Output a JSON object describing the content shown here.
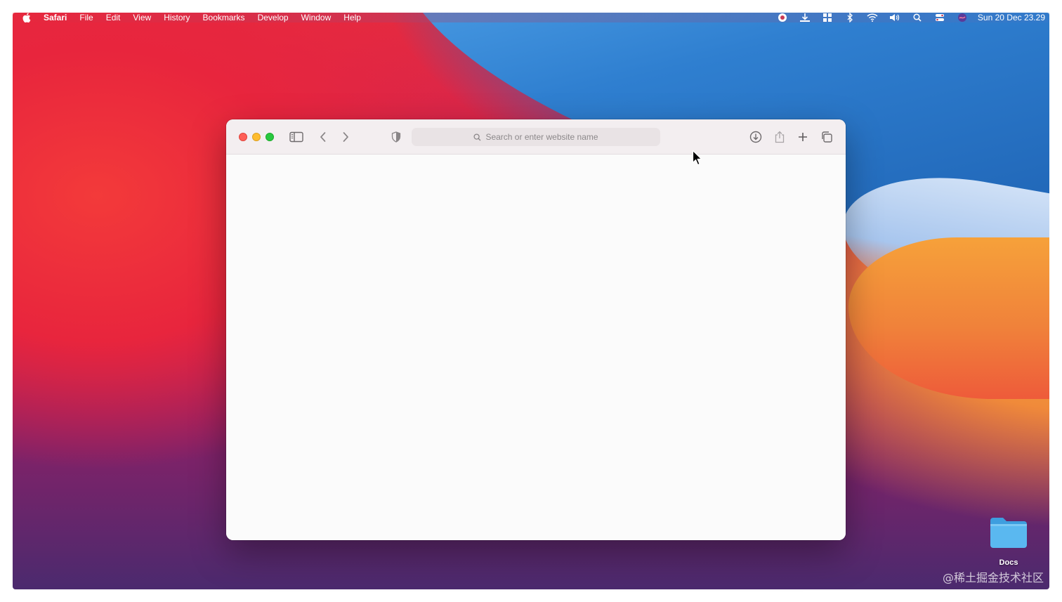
{
  "menubar": {
    "app_name": "Safari",
    "items": [
      "File",
      "Edit",
      "View",
      "History",
      "Bookmarks",
      "Develop",
      "Window",
      "Help"
    ],
    "clock": "Sun 20 Dec  23.29"
  },
  "browser": {
    "address_placeholder": "Search or enter website name"
  },
  "desktop": {
    "folder_label": "Docs",
    "watermark": "@稀土掘金技术社区"
  },
  "colors": {
    "close": "#fe5f57",
    "minimize": "#febc2e",
    "maximize": "#28c840",
    "folder": "#5ab8f0"
  }
}
